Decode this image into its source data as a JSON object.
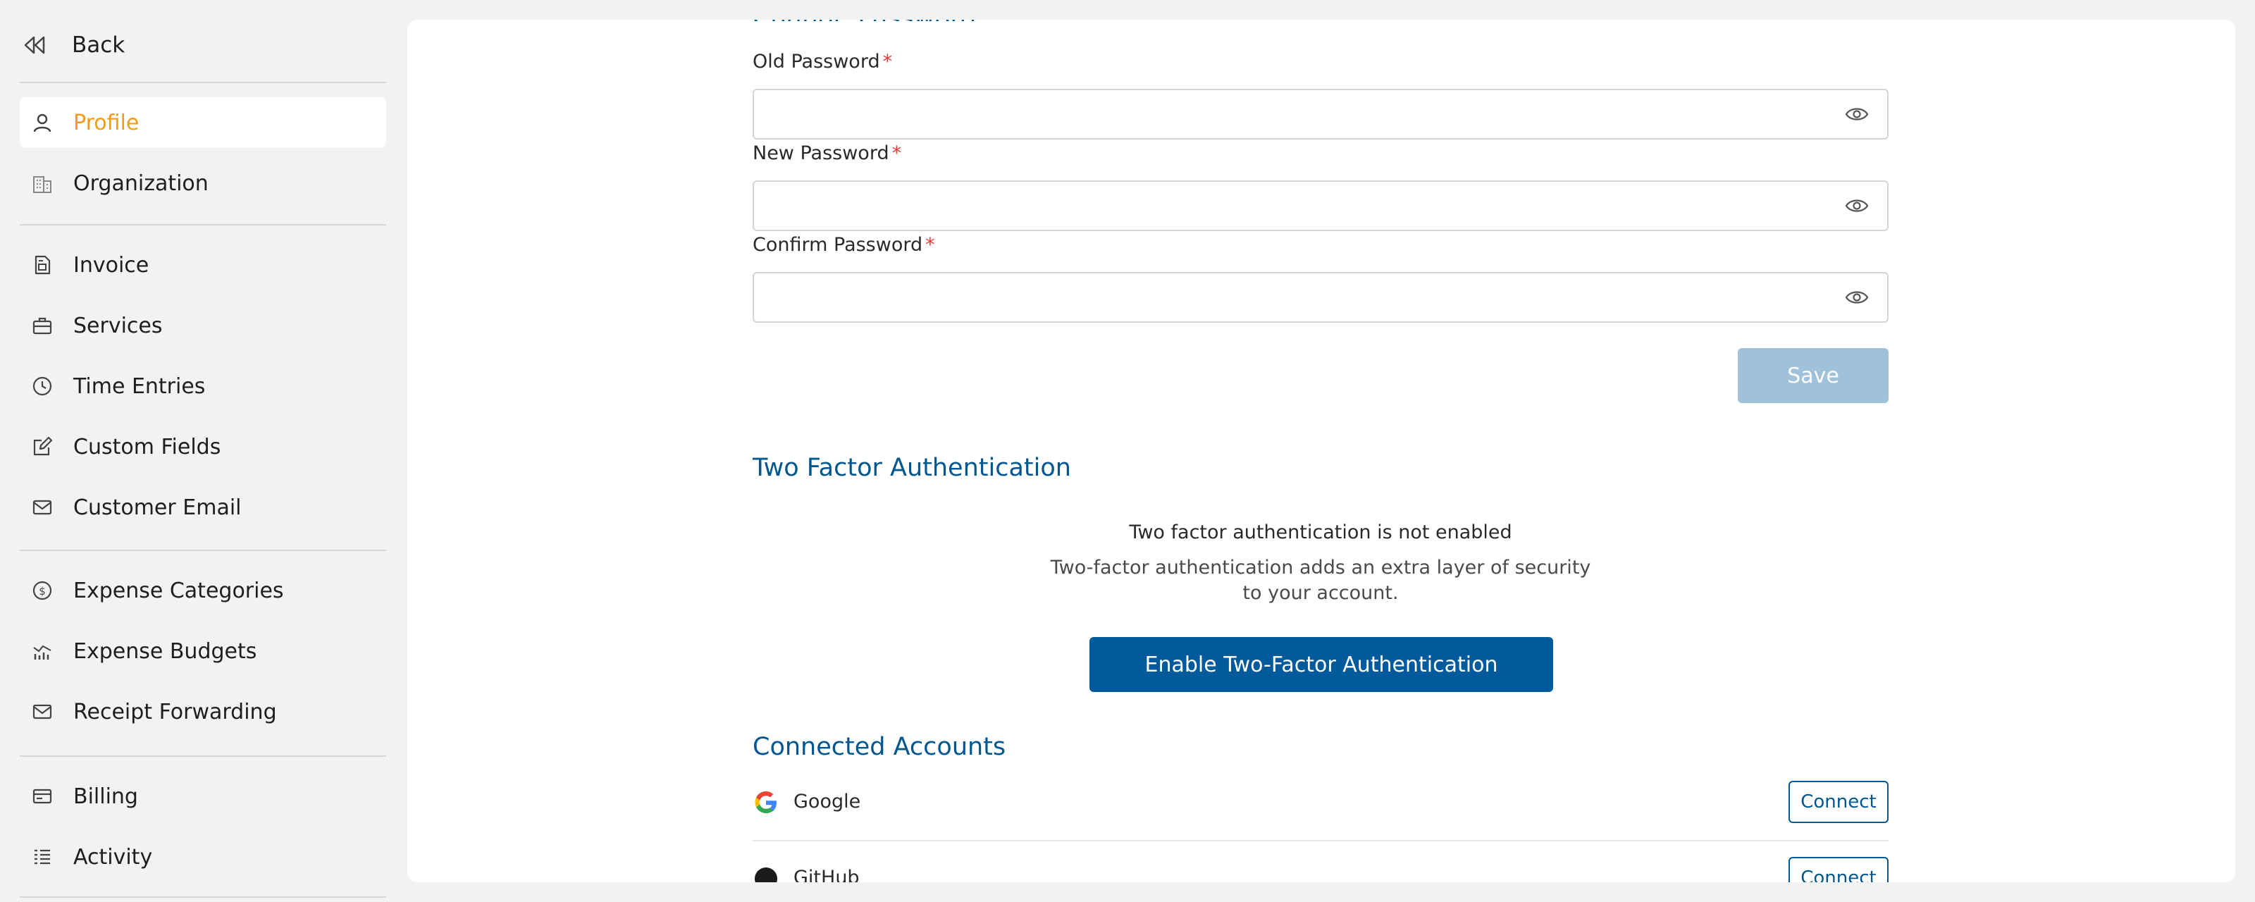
{
  "sidebar": {
    "back_label": "Back",
    "items": [
      {
        "label": "Profile",
        "icon": "user-icon",
        "active": true
      },
      {
        "label": "Organization",
        "icon": "building-icon"
      },
      {
        "label": "Invoice",
        "icon": "invoice-icon"
      },
      {
        "label": "Services",
        "icon": "briefcase-icon"
      },
      {
        "label": "Time Entries",
        "icon": "clock-icon"
      },
      {
        "label": "Custom Fields",
        "icon": "edit-icon"
      },
      {
        "label": "Customer Email",
        "icon": "mail-icon"
      },
      {
        "label": "Expense Categories",
        "icon": "dollar-circle-icon"
      },
      {
        "label": "Expense Budgets",
        "icon": "chart-icon"
      },
      {
        "label": "Receipt Forwarding",
        "icon": "mail-icon"
      },
      {
        "label": "Billing",
        "icon": "card-icon"
      },
      {
        "label": "Activity",
        "icon": "list-icon"
      }
    ]
  },
  "password": {
    "old_label": "Old Password",
    "new_label": "New Password",
    "confirm_label": "Confirm Password",
    "required_mark": "*",
    "old_value": "",
    "new_value": "",
    "confirm_value": "",
    "save_label": "Save"
  },
  "two_factor": {
    "title": "Two Factor Authentication",
    "status": "Two factor authentication is not enabled",
    "description": "Two-factor authentication adds an extra layer of security to your account.",
    "enable_label": "Enable Two-Factor Authentication"
  },
  "connected_accounts": {
    "title": "Connected Accounts",
    "google_name": "Google",
    "google_action": "Connect"
  },
  "colors": {
    "accent": "#005a9c",
    "active_nav": "#f39c1b",
    "save_disabled": "#9fc2da",
    "required": "#e53935"
  }
}
